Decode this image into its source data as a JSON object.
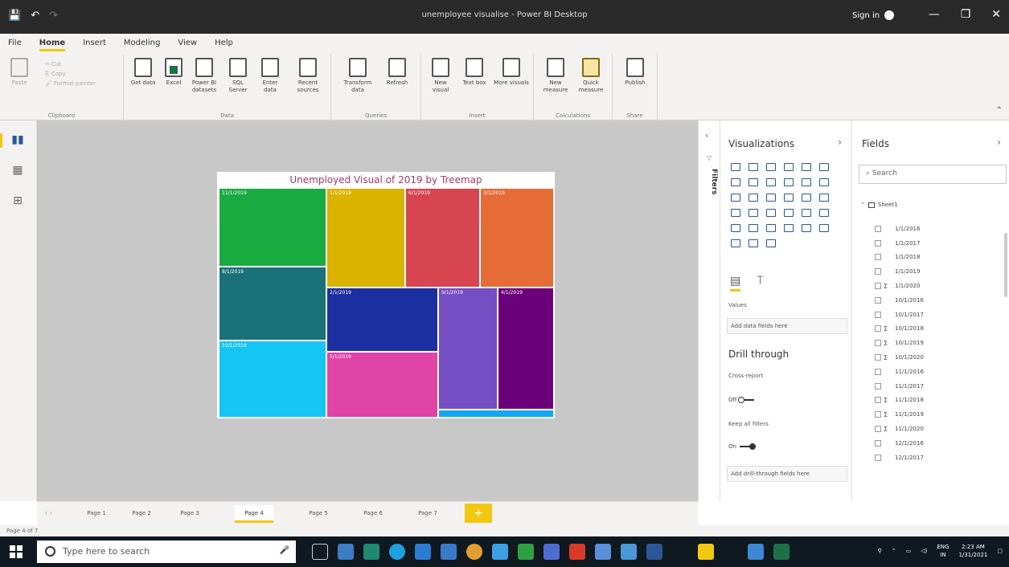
{
  "window": {
    "title": "unemployee visualise - Power BI Desktop",
    "signin": "Sign in"
  },
  "menu": [
    "File",
    "Home",
    "Insert",
    "Modeling",
    "View",
    "Help"
  ],
  "ribbon": {
    "clipboard": {
      "cut": "Cut",
      "copy": "Copy",
      "format_painter": "Format painter",
      "paste": "Paste",
      "label": "Clipboard"
    },
    "data": {
      "label": "Data",
      "buttons": [
        "Get data",
        "Excel",
        "Power BI datasets",
        "SQL Server",
        "Enter data",
        "Recent sources"
      ]
    },
    "queries": {
      "label": "Queries",
      "buttons": [
        "Transform data",
        "Refresh"
      ]
    },
    "insert": {
      "label": "Insert",
      "buttons": [
        "New visual",
        "Text box",
        "More visuals"
      ]
    },
    "calculations": {
      "label": "Calculations",
      "buttons": [
        "New measure",
        "Quick measure"
      ]
    },
    "share": {
      "label": "Share",
      "buttons": [
        "Publish"
      ]
    }
  },
  "report": {
    "title": "Unemployed Visual of 2019 by Treemap",
    "tiles": [
      {
        "label": "11/1/2019",
        "color": "#1aab40"
      },
      {
        "label": "1/1/2019",
        "color": "#d9b300"
      },
      {
        "label": "6/1/2019",
        "color": "#d64550"
      },
      {
        "label": "3/1/2019",
        "color": "#e66c37"
      },
      {
        "label": "8/1/2019",
        "color": "#197278"
      },
      {
        "label": "2/1/2019",
        "color": "#1c2fa0"
      },
      {
        "label": "9/1/2019",
        "color": "#744ec2"
      },
      {
        "label": "4/1/2019",
        "color": "#6b007b"
      },
      {
        "label": "10/1/2019",
        "color": "#15c6f4"
      },
      {
        "label": "5/1/2019",
        "color": "#e044a7"
      },
      {
        "label": "",
        "color": "#12a8f0"
      }
    ]
  },
  "filters": {
    "label": "Filters"
  },
  "visualizations": {
    "title": "Visualizations",
    "values_label": "Values",
    "values_placeholder": "Add data fields here",
    "drill_title": "Drill through",
    "cross_report": "Cross-report",
    "cross_report_state": "Off",
    "keep_filters": "Keep all filters",
    "keep_filters_state": "On",
    "drill_placeholder": "Add drill-through fields here",
    "icon_colors": [
      "#2b579a",
      "#2b579a",
      "#2b579a",
      "#2b579a",
      "#2b579a",
      "#2b579a",
      "#2b579a",
      "#2b579a",
      "#2b579a",
      "#2b579a",
      "#2b579a",
      "#2b579a",
      "#2b579a",
      "#2b579a",
      "#2b579a",
      "#2b579a",
      "#2b579a",
      "#2b579a",
      "#2b579a",
      "#2b579a",
      "#2b579a",
      "#2b579a",
      "#2b579a",
      "#2b579a",
      "#2b579a",
      "#2b579a",
      "#2b579a",
      "#2b579a",
      "#2b579a",
      "#2b579a",
      "#2b579a",
      "#2b579a",
      "#2b579a"
    ]
  },
  "fields": {
    "title": "Fields",
    "search_placeholder": "Search",
    "table": "Sheet1",
    "items": [
      {
        "name": "1/1/2016",
        "sigma": ""
      },
      {
        "name": "1/1/2017",
        "sigma": ""
      },
      {
        "name": "1/1/2018",
        "sigma": ""
      },
      {
        "name": "1/1/2019",
        "sigma": ""
      },
      {
        "name": "1/1/2020",
        "sigma": "Σ"
      },
      {
        "name": "10/1/2016",
        "sigma": ""
      },
      {
        "name": "10/1/2017",
        "sigma": ""
      },
      {
        "name": "10/1/2018",
        "sigma": "Σ"
      },
      {
        "name": "10/1/2019",
        "sigma": "Σ"
      },
      {
        "name": "10/1/2020",
        "sigma": "Σ"
      },
      {
        "name": "11/1/2016",
        "sigma": ""
      },
      {
        "name": "11/1/2017",
        "sigma": ""
      },
      {
        "name": "11/1/2018",
        "sigma": "Σ"
      },
      {
        "name": "11/1/2019",
        "sigma": "Σ"
      },
      {
        "name": "11/1/2020",
        "sigma": "Σ"
      },
      {
        "name": "12/1/2016",
        "sigma": ""
      },
      {
        "name": "12/1/2017",
        "sigma": ""
      }
    ]
  },
  "pages": {
    "tabs": [
      "Page 1",
      "Page 2",
      "Page 3",
      "Page 4",
      "Page 5",
      "Page 6",
      "Page 7"
    ],
    "active": "Page 4",
    "add": "+"
  },
  "status": "Page 4 of 7",
  "taskbar": {
    "search_placeholder": "Type here to search",
    "lang": "ENG",
    "region": "IN",
    "time": "2:23 AM",
    "date": "1/31/2021"
  }
}
